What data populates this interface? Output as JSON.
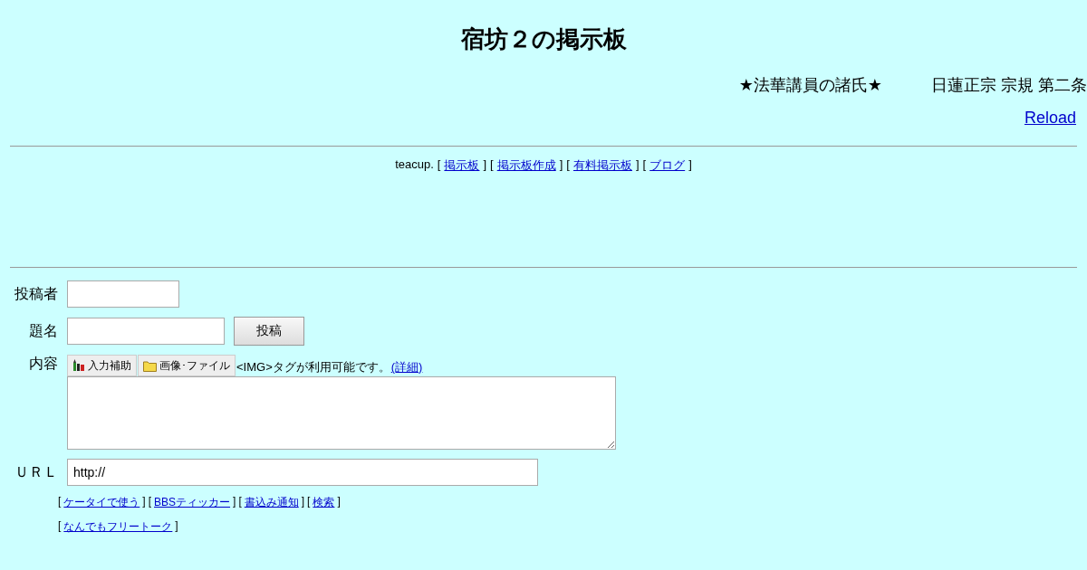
{
  "title": "宿坊２の掲示板",
  "marquee": [
    "★法華講員の諸氏★",
    "日蓮正宗 宗規 第二条"
  ],
  "reload": "Reload",
  "nav": {
    "prefix": "teacup.",
    "open": "[",
    "close": "]",
    "links": [
      "掲示板",
      "掲示板作成",
      "有料掲示板",
      "ブログ"
    ]
  },
  "form": {
    "name_label": "投稿者",
    "subject_label": "題名",
    "submit": "投稿",
    "content_label": "内容",
    "tools": [
      {
        "kind": "pencils",
        "label": "入力補助"
      },
      {
        "kind": "folder",
        "label": "画像･ファイル"
      }
    ],
    "img_note": "<IMG>タグが利用可能です。",
    "img_link": "(詳細)",
    "url_label": "ＵＲＬ",
    "url_value": "http://"
  },
  "footer_rows": [
    [
      "ケータイで使う",
      "BBSティッカー",
      "書込み通知",
      "検索"
    ],
    [
      "なんでもフリートーク"
    ]
  ]
}
